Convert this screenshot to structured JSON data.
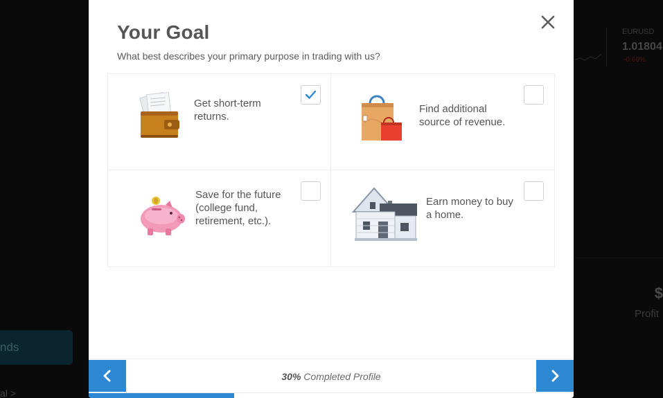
{
  "background": {
    "ticker_symbol": "EURUSD",
    "ticker_price": "1.01804",
    "ticker_change": "-0.66%",
    "panel_big": "$",
    "panel_small": "Profit",
    "button_label": "nds",
    "link_label": "al >"
  },
  "modal": {
    "title": "Your Goal",
    "subtitle": "What best describes your primary purpose in trading with us?",
    "close_icon": "close-icon",
    "options": [
      {
        "label": "Get short-term\nreturns.",
        "icon": "wallet-icon",
        "checked": true
      },
      {
        "label": "Find additional\nsource of revenue.",
        "icon": "shopping-bags-icon",
        "checked": false
      },
      {
        "label": "Save for the future\n(college fund,\nretirement, etc.).",
        "icon": "piggy-bank-icon",
        "checked": false
      },
      {
        "label": "Earn money to buy\na home.",
        "icon": "house-icon",
        "checked": false
      }
    ]
  },
  "footer": {
    "progress_percent": "30%",
    "progress_label": " Completed Profile",
    "progress_value": 0.3,
    "prev_icon": "chevron-left-icon",
    "next_icon": "chevron-right-icon"
  },
  "colors": {
    "accent": "#2d87d2",
    "check": "#2d87d2",
    "text": "#555555"
  }
}
